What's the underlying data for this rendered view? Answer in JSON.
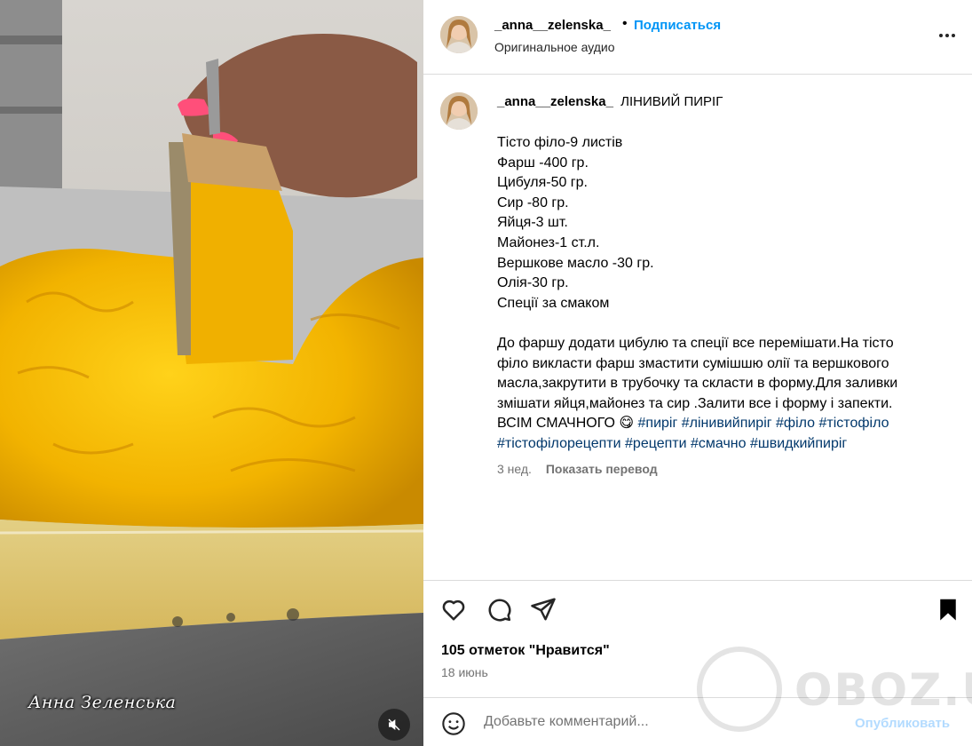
{
  "post": {
    "username": "_anna__zelenska_",
    "follow_label": "Подписаться",
    "separator": "•",
    "audio_label": "Оригинальное аудио",
    "more_icon": "more-horizontal-icon"
  },
  "media": {
    "signature_text": "Анна Зеленська",
    "mute_icon": "speaker-muted-icon"
  },
  "caption": {
    "username": "_anna__zelenska_",
    "title": "ЛІНИВИЙ ПИРІГ",
    "ingredients": [
      "Тісто філо-9 листів",
      "Фарш -400 гр.",
      "Цибуля-50 гр.",
      "Сир -80 гр.",
      "Яйця-3 шт.",
      "Майонез-1 ст.л.",
      "Вершкове масло -30 гр.",
      "Олія-30 гр.",
      "Спеції за смаком"
    ],
    "paragraph": [
      "До фаршу додати цибулю та спеції все перемішати.На тісто",
      "філо викласти фарш змастити сумішшю олії та вершкового",
      "масла,закрутити в трубочку та скласти в форму.Для заливки",
      "змішати яйця,майонез та сир .Залити все і форму і запекти."
    ],
    "closing": "ВСІМ СМАЧНОГО 😋",
    "hashtags_line1": [
      "#пиріг",
      "#лінивийпиріг",
      "#філо",
      "#тістофіло"
    ],
    "hashtags_line2": [
      "#тістофілорецепти",
      "#рецепти",
      "#смачно",
      "#швидкийпиріг"
    ],
    "time_ago": "3 нед.",
    "translate_label": "Показать перевод"
  },
  "actions": {
    "like_icon": "heart-icon",
    "comment_icon": "comment-bubble-icon",
    "share_icon": "paper-plane-icon",
    "save_icon": "bookmark-icon",
    "likes_text": "105 отметок \"Нравится\"",
    "date": "18 июнь"
  },
  "comment": {
    "emoji_icon": "smiley-icon",
    "placeholder": "Добавьте комментарий...",
    "publish_label": "Опубликовать"
  },
  "overlay": {
    "site_watermark": "OBOZ.UA"
  },
  "colors": {
    "accent_blue": "#0095f6",
    "hashtag": "#00376b",
    "secondary_text": "#737373",
    "border": "#dbdbdb",
    "pie_yellow": "#f2b300"
  }
}
